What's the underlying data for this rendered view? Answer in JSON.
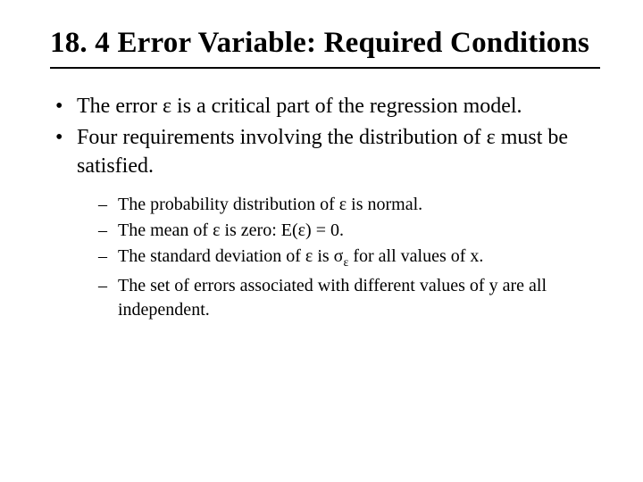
{
  "title": "18. 4  Error Variable: Required Conditions",
  "bullets": {
    "b1": "The error ε is a critical part of the regression model.",
    "b2": "Four requirements involving the distribution of ε must be satisfied.",
    "sub1": "The probability distribution of ε is normal.",
    "sub2": "The mean of ε is zero: E(ε) = 0.",
    "sub3_prefix": "The standard deviation of ε is σ",
    "sub3_sub": "ε",
    "sub3_suffix": " for all values of x.",
    "sub4": "The set of errors associated with different values of y are all independent."
  }
}
